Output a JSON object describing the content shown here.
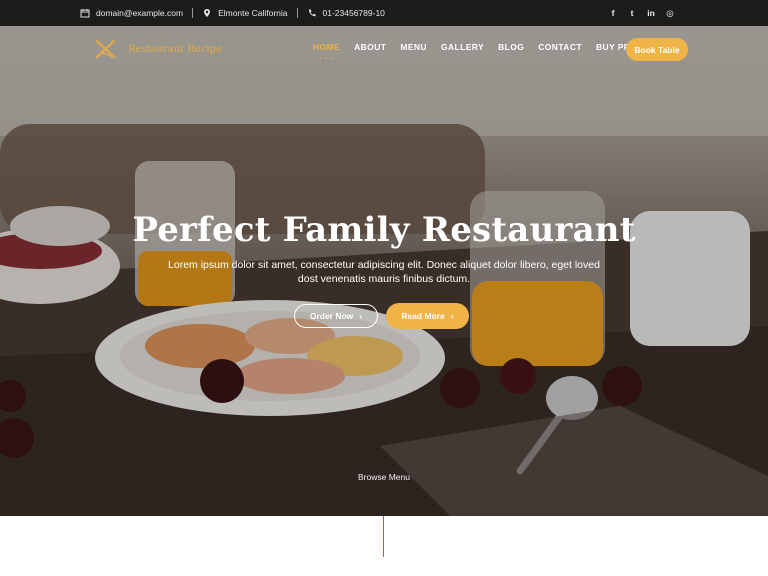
{
  "topbar": {
    "email": "domain@example.com",
    "location": "Elmonte California",
    "phone": "01-23456789-10",
    "social": [
      {
        "icon": "facebook-icon",
        "glyph": "f"
      },
      {
        "icon": "twitter-icon",
        "glyph": "t"
      },
      {
        "icon": "linkedin-icon",
        "glyph": "in"
      },
      {
        "icon": "instagram-icon",
        "glyph": "◎"
      }
    ]
  },
  "header": {
    "logo_text": "Restaurant Recipe",
    "nav": [
      "HOME",
      "ABOUT",
      "MENU",
      "GALLERY",
      "BLOG",
      "CONTACT",
      "BUY PRO"
    ],
    "active_nav": "HOME",
    "book_button": "Book Table"
  },
  "hero": {
    "title": "Perfect Family Restaurant",
    "description": "Lorem ipsum dolor sit amet, consectetur adipiscing elit. Donec aliquet dolor libero, eget loved dost venenatis mauris finibus dictum.",
    "primary_button": "Order Now",
    "secondary_button": "Read More",
    "browse_label": "Browse Menu"
  },
  "colors": {
    "accent": "#f0b348",
    "topbar_bg": "#1c1c1c",
    "divider": "#d94b4b"
  }
}
